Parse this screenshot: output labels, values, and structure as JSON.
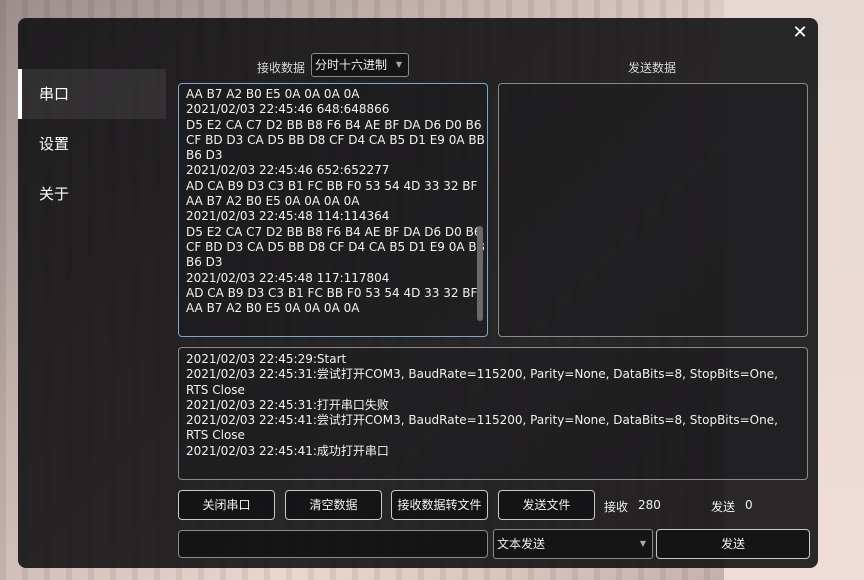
{
  "window": {
    "close_label": "✕"
  },
  "sidebar": {
    "items": [
      {
        "label": "串口",
        "active": true
      },
      {
        "label": "设置",
        "active": false
      },
      {
        "label": "关于",
        "active": false
      }
    ]
  },
  "receive": {
    "label": "接收数据",
    "mode": "分时十六进制",
    "lines": [
      "AA B7 A2 B0 E5 0A 0A 0A 0A",
      "2021/02/03 22:45:46  648:648866",
      "D5 E2 CA C7 D2 BB B8 F6 B4 AE BF DA D6 D0 B6",
      "CF BD D3 CA D5 BB D8 CF D4 CA B5 D1 E9 0A BB",
      "B6 D3",
      "2021/02/03 22:45:46  652:652277",
      "AD CA B9 D3 C3 B1 FC BB F0 53 54 4D 33 32 BF",
      "AA B7 A2 B0 E5 0A 0A 0A 0A",
      "2021/02/03 22:45:48  114:114364",
      "D5 E2 CA C7 D2 BB B8 F6 B4 AE BF DA D6 D0 B6",
      "CF BD D3 CA D5 BB D8 CF D4 CA B5 D1 E9 0A BB",
      "B6 D3",
      "2021/02/03 22:45:48  117:117804",
      "AD CA B9 D3 C3 B1 FC BB F0 53 54 4D 33 32 BF",
      "AA B7 A2 B0 E5 0A 0A 0A 0A"
    ]
  },
  "send": {
    "label": "发送数据"
  },
  "log": {
    "lines": [
      "2021/02/03 22:45:29:Start",
      "2021/02/03 22:45:31:尝试打开COM3, BaudRate=115200, Parity=None, DataBits=8, StopBits=One, RTS Close",
      "2021/02/03 22:45:31:打开串口失败",
      "2021/02/03 22:45:41:尝试打开COM3, BaudRate=115200, Parity=None, DataBits=8, StopBits=One, RTS Close",
      "2021/02/03 22:45:41:成功打开串口"
    ]
  },
  "toolbar": {
    "close_port": "关闭串口",
    "clear_data": "清空数据",
    "receive_to_file": "接收数据转文件",
    "send_file": "发送文件",
    "rx_label": "接收",
    "rx_count": "280",
    "tx_label": "发送",
    "tx_count": "0"
  },
  "footer": {
    "input_value": "",
    "send_mode": "文本发送",
    "send_button": "发送"
  }
}
